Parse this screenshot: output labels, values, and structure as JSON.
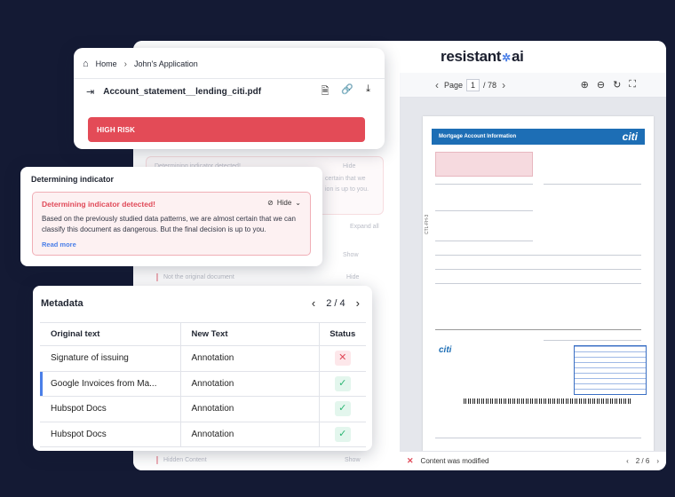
{
  "brand": {
    "name_left": "resistant",
    "name_right": "ai"
  },
  "breadcrumb": {
    "home": "Home",
    "current": "John's Application"
  },
  "file": {
    "name": "Account_statement__lending_citi.pdf"
  },
  "risk": {
    "label": "HIGH RISK",
    "color": "#e34b57"
  },
  "indicator": {
    "section_title": "Determining indicator",
    "heading": "Determining indicator detected!",
    "hide_label": "Hide",
    "body": "Based on the previously studied data patterns, we are almost certain that we can classify this document as dangerous. But the final decision is up to you.",
    "read_more": "Read more"
  },
  "background_rows": {
    "determining_faded": "Determining indicator detected!",
    "hide_faded": "Hide",
    "body_faded_1": "certain that we",
    "body_faded_2": "ion is up to you.",
    "expand_all": "Expand all",
    "show_1": "Show",
    "not_original": "Not the original document",
    "hide_2": "Hide",
    "hidden_content": "Hidden Content",
    "show_2": "Show"
  },
  "viewer": {
    "page_label": "Page",
    "current_page": "1",
    "total_pages": "/ 78",
    "footer_status": "Content was modified",
    "footer_pager": "2 / 6"
  },
  "document": {
    "header_title": "Mortgage Account Information",
    "logo": "citi",
    "vertical_code": "CTL-FH-3"
  },
  "metadata": {
    "title": "Metadata",
    "pager": "2 / 4",
    "columns": [
      "Original text",
      "New Text",
      "Status"
    ],
    "rows": [
      {
        "original": "Signature of issuing",
        "new": "Annotation",
        "status": "rejected"
      },
      {
        "original": "Google Invoices from Ma...",
        "new": "Annotation",
        "status": "accepted"
      },
      {
        "original": "Hubspot Docs",
        "new": "Annotation",
        "status": "accepted"
      },
      {
        "original": "Hubspot Docs",
        "new": "Annotation",
        "status": "accepted"
      }
    ]
  },
  "colors": {
    "accent": "#4a7fe8",
    "danger": "#e04a59",
    "success": "#2bb673",
    "background": "#141a34"
  }
}
